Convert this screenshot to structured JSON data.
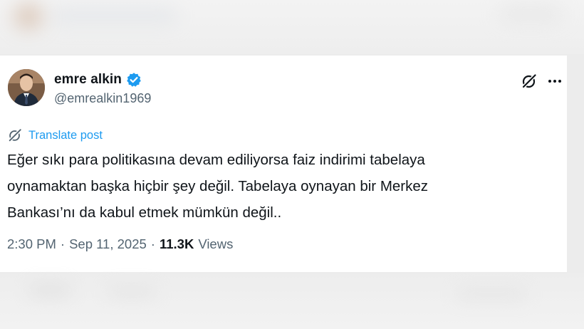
{
  "author": {
    "name": "emre alkin",
    "handle": "@emrealkin1969",
    "verified": true
  },
  "translate": {
    "label": "Translate post"
  },
  "tweet": {
    "text": "Eğer sıkı para politikasına devam ediliyorsa faiz indirimi tabelaya\noynamaktan başka hiçbir şey değil. Tabelaya oynayan bir Merkez\nBankası’nı da kabul etmek mümkün değil.."
  },
  "meta": {
    "time": "2:30 PM",
    "separator1": "·",
    "date": "Sep 11, 2025",
    "separator2": "·",
    "views_count": "11.3K",
    "views_label": "Views"
  },
  "icons": {
    "verified": "verified-badge-icon",
    "grok": "grok-icon",
    "more": "more-options-icon",
    "translate": "translate-icon"
  },
  "colors": {
    "accent": "#1d9bf0",
    "text_primary": "#0f1419",
    "text_secondary": "#536471"
  }
}
